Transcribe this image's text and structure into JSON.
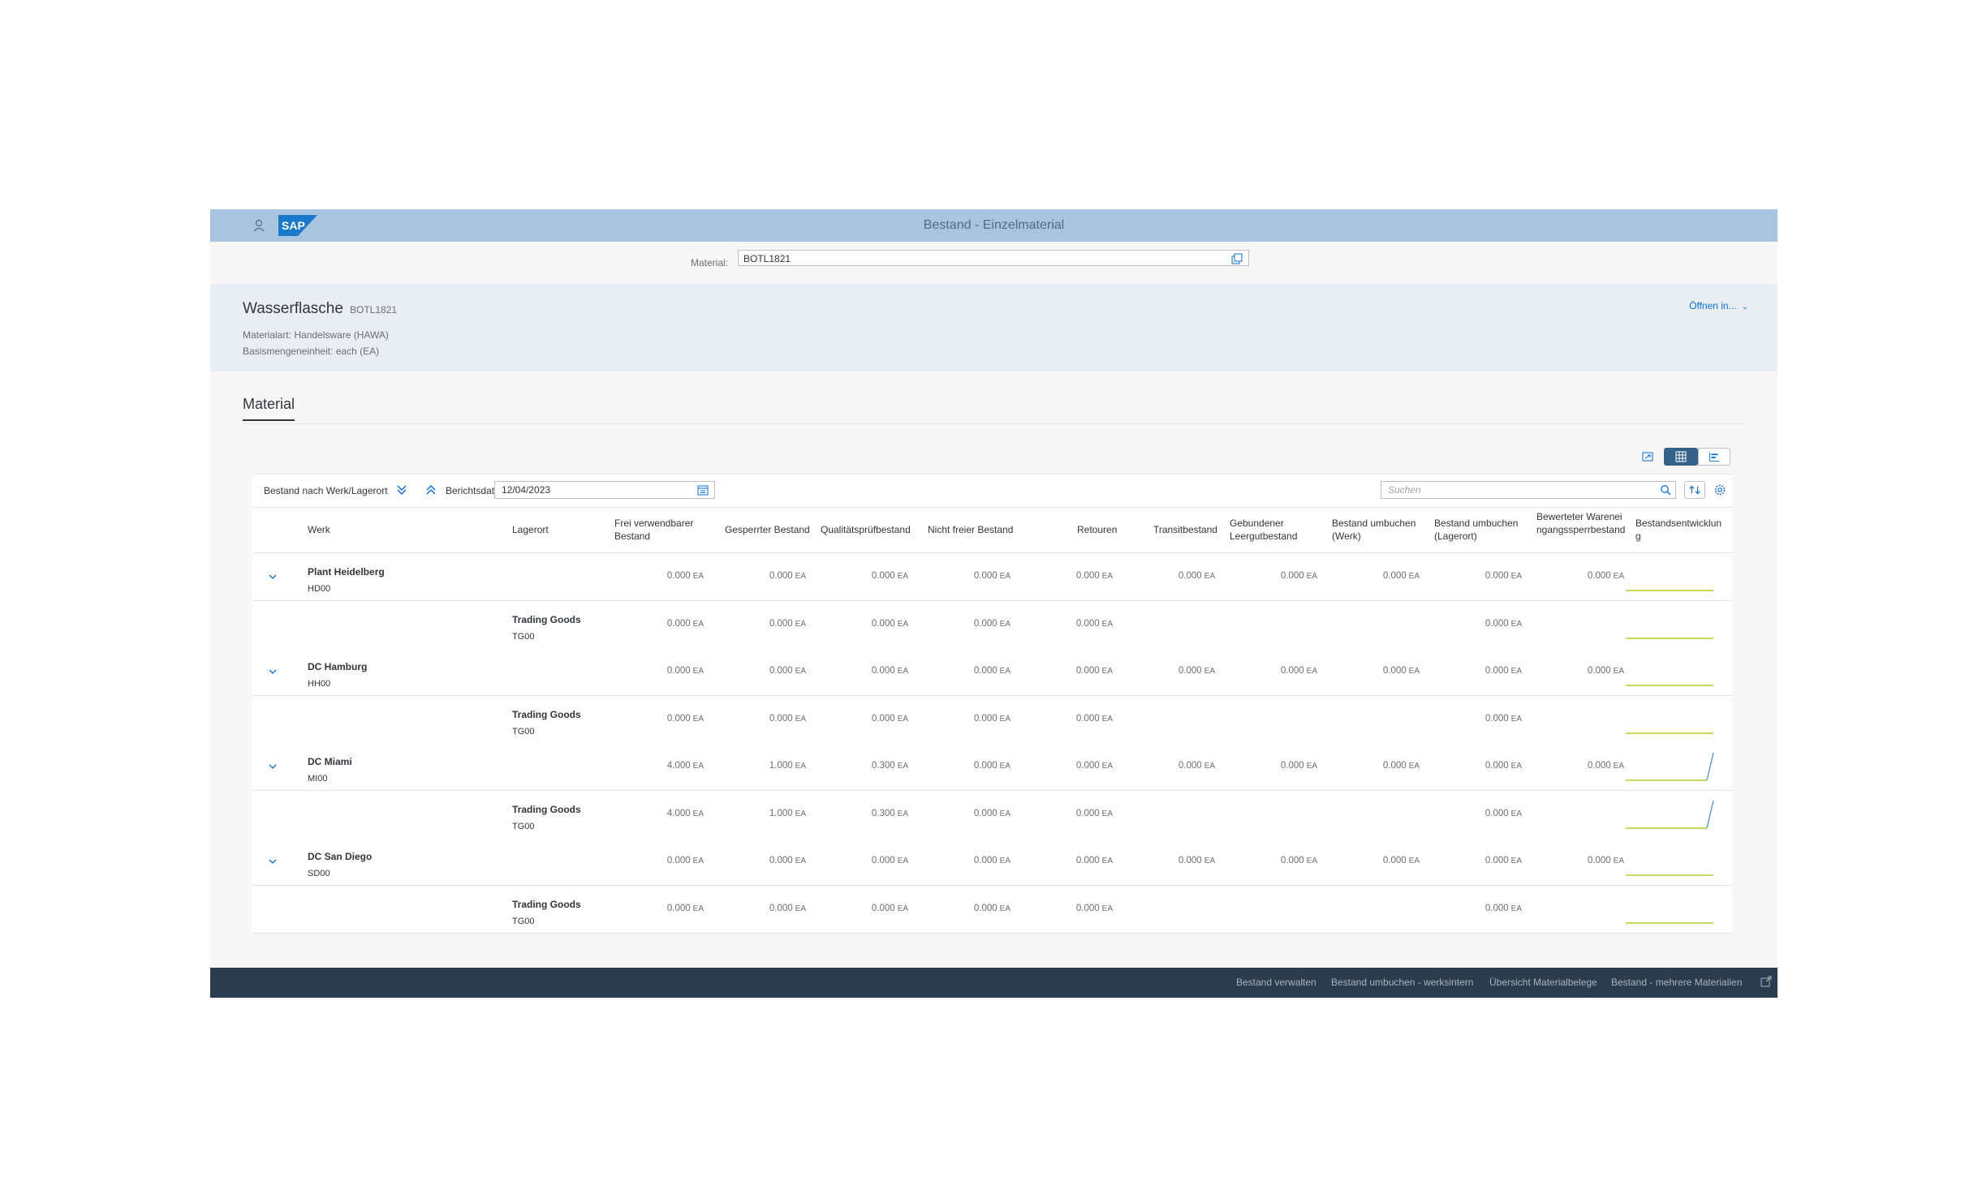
{
  "shell": {
    "title": "Bestand - Einzelmaterial",
    "logo_text": "SAP"
  },
  "material_bar": {
    "label": "Material:",
    "value": "BOTL1821"
  },
  "header": {
    "title": "Wasserflasche",
    "subtitle": "BOTL1821",
    "attr1": "Materialart: Handelsware (HAWA)",
    "attr2": "Basismengeneinheit: each (EA)",
    "open_in": "Öffnen in..."
  },
  "tabs": {
    "material": "Material"
  },
  "toolbar": {
    "title": "Bestand nach Werk/Lagerort",
    "date_label": "Berichtsdatum",
    "date_value": "12/04/2023",
    "search_placeholder": "Suchen"
  },
  "columns": {
    "werk": "Werk",
    "lagerort": "Lagerort",
    "frei": "Frei verwendbarer Bestand",
    "gesperrt": "Gesperrter Bestand",
    "qualitaet": "Qualitätsprüfbestand",
    "nichtfrei": "Nicht freier Bestand",
    "retouren": "Retouren",
    "transit": "Transitbestand",
    "leergut": "Gebundener Leergutbestand",
    "umb_werk": "Bestand umbuchen (Werk)",
    "umb_lager": "Bestand umbuchen (Lagerort)",
    "sperr": "Bewerteter Wareneingangssperrbestand",
    "entwicklung": "Bestandsentwicklung"
  },
  "unit": "EA",
  "rows": [
    {
      "name": "Plant Heidelberg",
      "code": "HD00",
      "level": "plant",
      "frei": "0.000",
      "gesperrt": "0.000",
      "qualitaet": "0.000",
      "nichtfrei": "0.000",
      "retouren": "0.000",
      "transit": "0.000",
      "leergut": "0.000",
      "umb_werk": "0.000",
      "umb_lager": "0.000",
      "sperr": "0.000",
      "trend": "flat"
    },
    {
      "name": "Trading Goods",
      "code": "TG00",
      "level": "storage",
      "frei": "0.000",
      "gesperrt": "0.000",
      "qualitaet": "0.000",
      "nichtfrei": "0.000",
      "retouren": "0.000",
      "umb_lager": "0.000",
      "trend": "flat"
    },
    {
      "name": "DC Hamburg",
      "code": "HH00",
      "level": "plant",
      "frei": "0.000",
      "gesperrt": "0.000",
      "qualitaet": "0.000",
      "nichtfrei": "0.000",
      "retouren": "0.000",
      "transit": "0.000",
      "leergut": "0.000",
      "umb_werk": "0.000",
      "umb_lager": "0.000",
      "sperr": "0.000",
      "trend": "flat"
    },
    {
      "name": "Trading Goods",
      "code": "TG00",
      "level": "storage",
      "frei": "0.000",
      "gesperrt": "0.000",
      "qualitaet": "0.000",
      "nichtfrei": "0.000",
      "retouren": "0.000",
      "umb_lager": "0.000",
      "trend": "flat"
    },
    {
      "name": "DC Miami",
      "code": "MI00",
      "level": "plant",
      "frei": "4.000",
      "gesperrt": "1.000",
      "qualitaet": "0.300",
      "nichtfrei": "0.000",
      "retouren": "0.000",
      "transit": "0.000",
      "leergut": "0.000",
      "umb_werk": "0.000",
      "umb_lager": "0.000",
      "sperr": "0.000",
      "trend": "up"
    },
    {
      "name": "Trading Goods",
      "code": "TG00",
      "level": "storage",
      "frei": "4.000",
      "gesperrt": "1.000",
      "qualitaet": "0.300",
      "nichtfrei": "0.000",
      "retouren": "0.000",
      "umb_lager": "0.000",
      "trend": "up"
    },
    {
      "name": "DC San Diego",
      "code": "SD00",
      "level": "plant",
      "frei": "0.000",
      "gesperrt": "0.000",
      "qualitaet": "0.000",
      "nichtfrei": "0.000",
      "retouren": "0.000",
      "transit": "0.000",
      "leergut": "0.000",
      "umb_werk": "0.000",
      "umb_lager": "0.000",
      "sperr": "0.000",
      "trend": "flat"
    },
    {
      "name": "Trading Goods",
      "code": "TG00",
      "level": "storage",
      "frei": "0.000",
      "gesperrt": "0.000",
      "qualitaet": "0.000",
      "nichtfrei": "0.000",
      "retouren": "0.000",
      "umb_lager": "0.000",
      "trend": "flat"
    }
  ],
  "footer": {
    "links": [
      "Bestand verwalten",
      "Bestand umbuchen - werksintern",
      "Übersicht Materialbelege",
      "Bestand - mehrere Materialien"
    ]
  },
  "colors": {
    "shell": "#a9c4df",
    "header_bg": "#e9eef4",
    "footer_bg": "#2b3c4e",
    "accent": "#0a6ed1",
    "spark_flat": "#a4c400",
    "spark_up": "#5899da"
  }
}
